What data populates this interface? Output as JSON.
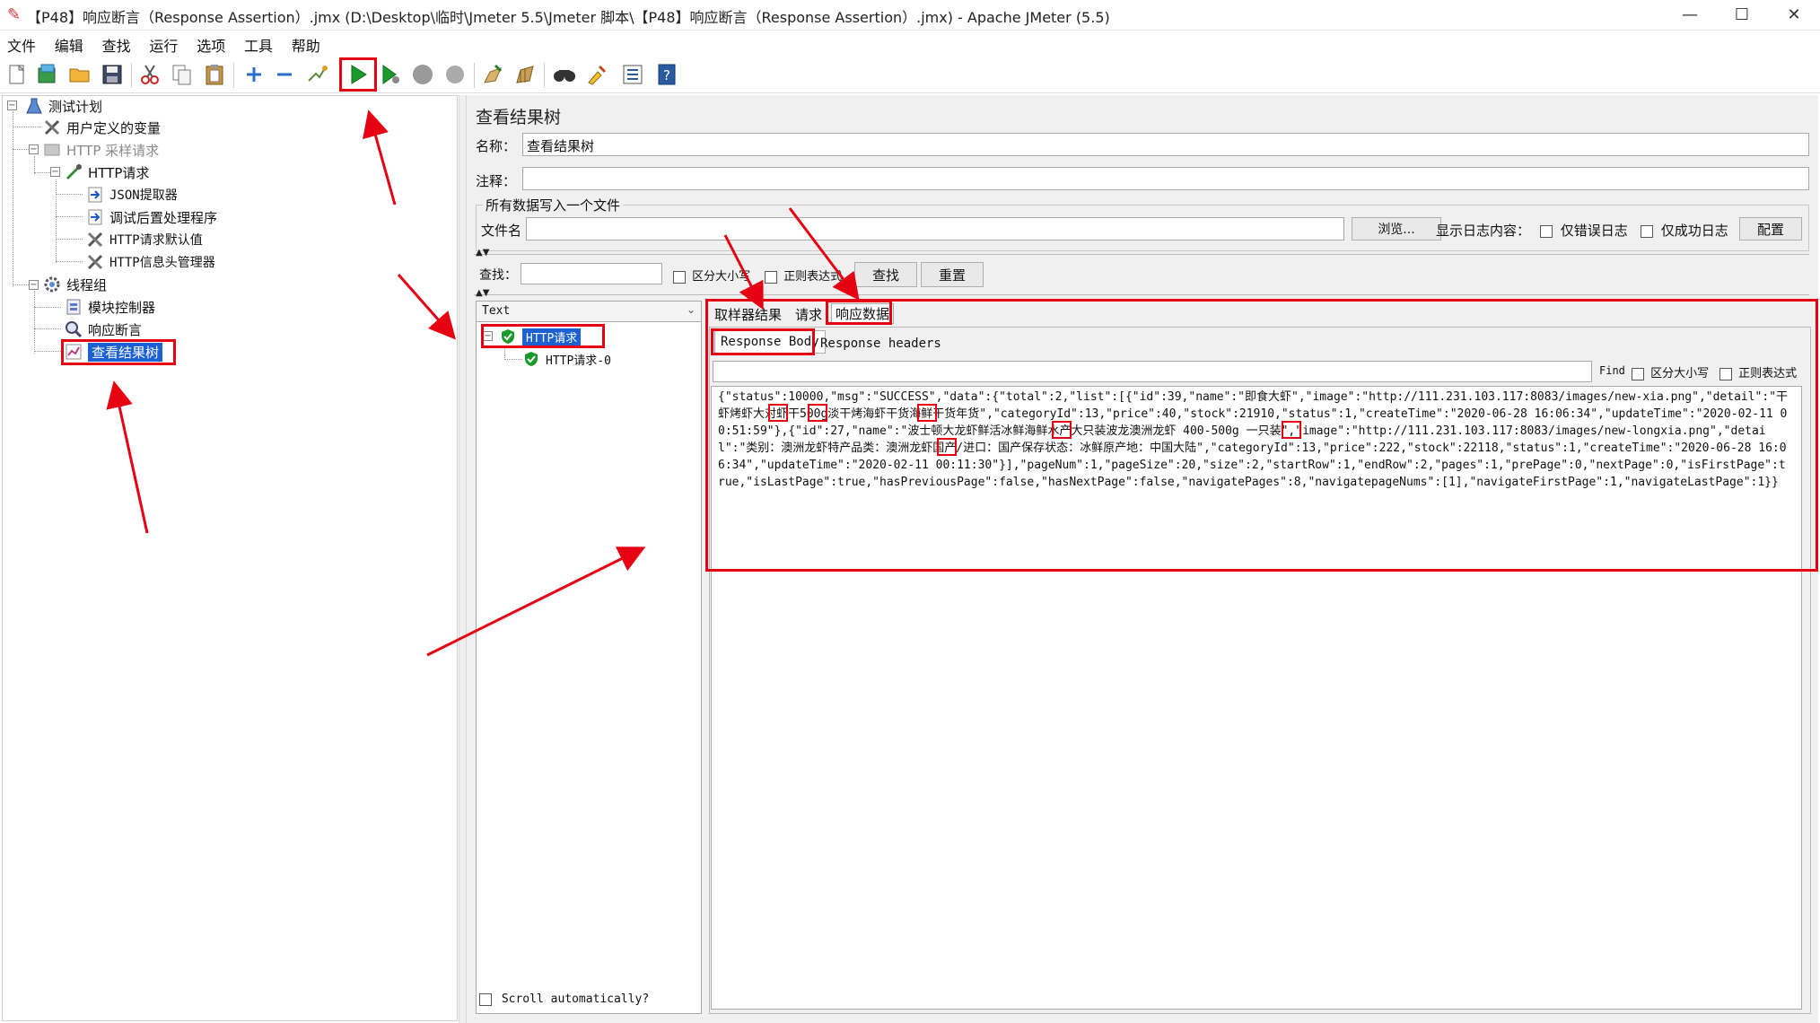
{
  "window": {
    "title": "【P48】响应断言（Response Assertion）.jmx (D:\\Desktop\\临时\\Jmeter 5.5\\Jmeter 脚本\\【P48】响应断言（Response Assertion）.jmx) - Apache JMeter (5.5)",
    "minimize": "—",
    "maximize": "☐",
    "close": "✕"
  },
  "menu": [
    "文件",
    "编辑",
    "查找",
    "运行",
    "选项",
    "工具",
    "帮助"
  ],
  "toolbar": {
    "icons": [
      "new-icon",
      "templates-icon",
      "open-icon",
      "save-icon",
      "cut-icon",
      "copy-icon",
      "paste-icon",
      "expand-icon",
      "collapse-icon",
      "toggle-icon",
      "start-icon",
      "start-no-pauses-icon",
      "stop-icon",
      "shutdown-icon",
      "clear-icon",
      "clear-all-icon",
      "search-icon",
      "reset-search-icon",
      "function-helper-icon",
      "help-icon"
    ]
  },
  "tree": {
    "test_plan": "测试计划",
    "user_vars": "用户定义的变量",
    "http_sampler_disabled": "HTTP 采样请求",
    "http_request": "HTTP请求",
    "json_extractor": "JSON提取器",
    "debug_post": "调试后置处理程序",
    "http_defaults": "HTTP请求默认值",
    "http_header": "HTTP信息头管理器",
    "thread_group": "线程组",
    "module_controller": "模块控制器",
    "response_assertion": "响应断言",
    "view_results_tree": "查看结果树"
  },
  "panel": {
    "title": "查看结果树",
    "name_label": "名称：",
    "name_value": "查看结果树",
    "comment_label": "注释：",
    "comment_value": "",
    "file_group_label": "所有数据写入一个文件",
    "filename_label": "文件名",
    "filename_value": "",
    "browse_button": "浏览...",
    "log_display_label": "显示日志内容：",
    "errors_only": "仅错误日志",
    "success_only": "仅成功日志",
    "configure_button": "配置",
    "search_label": "查找：",
    "search_value": "",
    "case_sensitive": "区分大小写",
    "regex": "正则表达式",
    "find_button": "查找",
    "reset_button": "重置"
  },
  "results": {
    "renderer": "Text",
    "items": [
      "HTTP请求",
      "HTTP请求-0"
    ],
    "scroll_auto": "Scroll automatically?"
  },
  "tabs": [
    "取样器结果",
    "请求",
    "响应数据"
  ],
  "subtabs": [
    "Response Body",
    "Response headers"
  ],
  "find_bar": {
    "find_label": "Find",
    "case_label": "区分大小写",
    "regex_label": "正则表达式"
  },
  "response_body": "{\"status\":10000,\"msg\":\"SUCCESS\",\"data\":{\"total\":2,\"list\":[{\"id\":39,\"name\":\"即食大虾\",\"image\":\"http://111.231.103.117:8083/images/new-xia.png\",\"detail\":\"干虾烤虾大对虾干500g淡干烤海虾干货海鲜干货年货\",\"categoryId\":13,\"price\":40,\"stock\":21910,\"status\":1,\"createTime\":\"2020-06-28 16:06:34\",\"updateTime\":\"2020-02-11 00:51:59\"},{\"id\":27,\"name\":\"波士顿大龙虾鲜活冰鲜海鲜水产大只装波龙澳洲龙虾 400-500g 一只装\",\"image\":\"http://111.231.103.117:8083/images/new-longxia.png\",\"detail\":\"类别：澳洲龙虾特产品类：澳洲龙虾国产/进口：国产保存状态：冰鲜原产地：中国大陆\",\"categoryId\":13,\"price\":222,\"stock\":22118,\"status\":1,\"createTime\":\"2020-06-28 16:06:34\",\"updateTime\":\"2020-02-11 00:11:30\"}],\"pageNum\":1,\"pageSize\":20,\"size\":2,\"startRow\":1,\"endRow\":2,\"pages\":1,\"prePage\":0,\"nextPage\":0,\"isFirstPage\":true,\"isLastPage\":true,\"hasPreviousPage\":false,\"hasNextPage\":false,\"navigatePages\":8,\"navigatepageNums\":[1],\"navigateFirstPage\":1,\"navigateLastPage\":1}}",
  "colors": {
    "annotation": "#e60012",
    "selection": "#1c61d4",
    "run_green": "#1a9a2a"
  }
}
